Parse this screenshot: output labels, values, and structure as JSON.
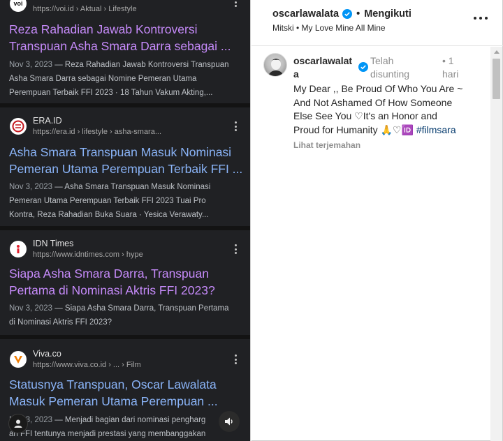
{
  "search_results": [
    {
      "source_name": "",
      "url": "https://voi.id › Aktual › Lifestyle",
      "favicon": "voi-logo",
      "title_lines": [
        "Reza Rahadian Jawab Kontroversi",
        "Transpuan Asha Smara Darra sebagai ..."
      ],
      "visited": true,
      "date": "Nov 3, 2023",
      "snippet_lines": [
        "Reza Rahadian Jawab Kontroversi Transpuan",
        "Asha Smara Darra sebagai Nomine Pemeran Utama",
        "Perempuan Terbaik FFI 2023 · 18 Tahun Vakum Akting,..."
      ]
    },
    {
      "source_name": "ERA.ID",
      "url": "https://era.id › lifestyle › asha-smara...",
      "favicon": "era-logo",
      "title_lines": [
        "Asha Smara Transpuan Masuk Nominasi",
        "Pemeran Utama Perempuan Terbaik FFI ..."
      ],
      "visited": false,
      "date": "Nov 3, 2023",
      "snippet_lines": [
        "Asha Smara Transpuan Masuk Nominasi",
        "Pemeran Utama Perempuan Terbaik FFI 2023 Tuai Pro",
        "Kontra, Reza Rahadian Buka Suara · Yesica Verawaty..."
      ]
    },
    {
      "source_name": "IDN Times",
      "url": "https://www.idntimes.com › hype",
      "favicon": "idn-logo",
      "title_lines": [
        "Siapa Asha Smara Darra, Transpuan",
        "Pertama di Nominasi Aktris FFI 2023?"
      ],
      "visited": true,
      "date": "Nov 3, 2023",
      "snippet_lines": [
        "Siapa Asha Smara Darra, Transpuan Pertama",
        "di Nominasi Aktris FFI 2023?"
      ]
    },
    {
      "source_name": "Viva.co",
      "url": "https://www.viva.co.id › ... › Film",
      "favicon": "viva-logo",
      "title_lines": [
        "Statusnya Transpuan, Oscar Lawalata",
        "Masuk Pemeran Utama Perempuan ..."
      ],
      "visited": false,
      "date": "Nov 3, 2023",
      "snippet_lines": [
        "Menjadi bagian dari nominasi pengharg",
        "an FFI tentunya menjadi prestasi yang membanggakan"
      ]
    }
  ],
  "snippet_dash": "—",
  "colors": {
    "visited_link": "#c58af9",
    "link": "#8ab4f8",
    "verified": "#0095f6",
    "hashtag": "#00376b"
  },
  "instagram": {
    "header_username": "oscarlawalata",
    "dot": "•",
    "follow_status": "Mengikuti",
    "music": "Mitski • My Love Mine All Mine",
    "comment": {
      "username_lines": [
        "oscarlawalat",
        "a"
      ],
      "edited_lines": [
        "Telah",
        "disunting"
      ],
      "time_lines": [
        "• 1",
        "hari"
      ],
      "text_lines": [
        "My Dear ,, Be Proud Of Who You Are ~",
        "And Not Ashamed Of How Someone",
        "Else See You ♡It's an Honor and",
        "Proud for Humanity 🙏♡🆔"
      ],
      "hashtag": "#filmsara",
      "translate": "Lihat terjemahan"
    }
  },
  "icons": {
    "kebab": "more-vert-icon",
    "more": "more-horiz-icon",
    "verified": "verified-badge-icon",
    "user": "user-icon",
    "speaker": "speaker-icon"
  }
}
